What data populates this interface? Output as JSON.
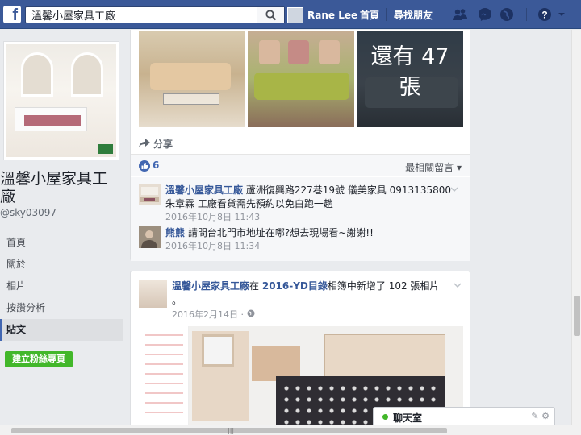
{
  "header": {
    "search_value": "溫馨小屋家具工廠",
    "profile_name": "Rane Lee",
    "nav": [
      "首頁",
      "尋找朋友"
    ],
    "brand_color": "#3b5998"
  },
  "page_info": {
    "name": "溫馨小屋家具工廠",
    "username": "@sky03097",
    "nav_items": [
      "首頁",
      "關於",
      "相片",
      "按讚分析",
      "貼文"
    ],
    "active_item": "貼文",
    "create_button": "建立粉絲專頁"
  },
  "post1": {
    "more_photos": "還有 47 張",
    "share_label": "分享",
    "like_count": "6",
    "sort_label": "最相關留言",
    "comments": [
      {
        "author": "溫馨小屋家具工廠",
        "text": "蘆洲復興路227巷19號 儀美家具 0913135800朱章霖 工廠看貨需先預約以免白跑一趟",
        "time": "2016年10月8日 11:43"
      },
      {
        "author": "熊熊",
        "text": "請問台北門市地址在哪?想去現場看~謝謝!!",
        "time": "2016年10月8日 11:34"
      }
    ]
  },
  "post2": {
    "author": "溫馨小屋家具工廠",
    "connector": "在",
    "album": "2016-YD目錄",
    "action": "相簿中新增了 102 張相片",
    "suffix": "。",
    "time": "2016年2月14日"
  },
  "chat": {
    "label": "聊天室",
    "status_color": "#42b72a"
  }
}
